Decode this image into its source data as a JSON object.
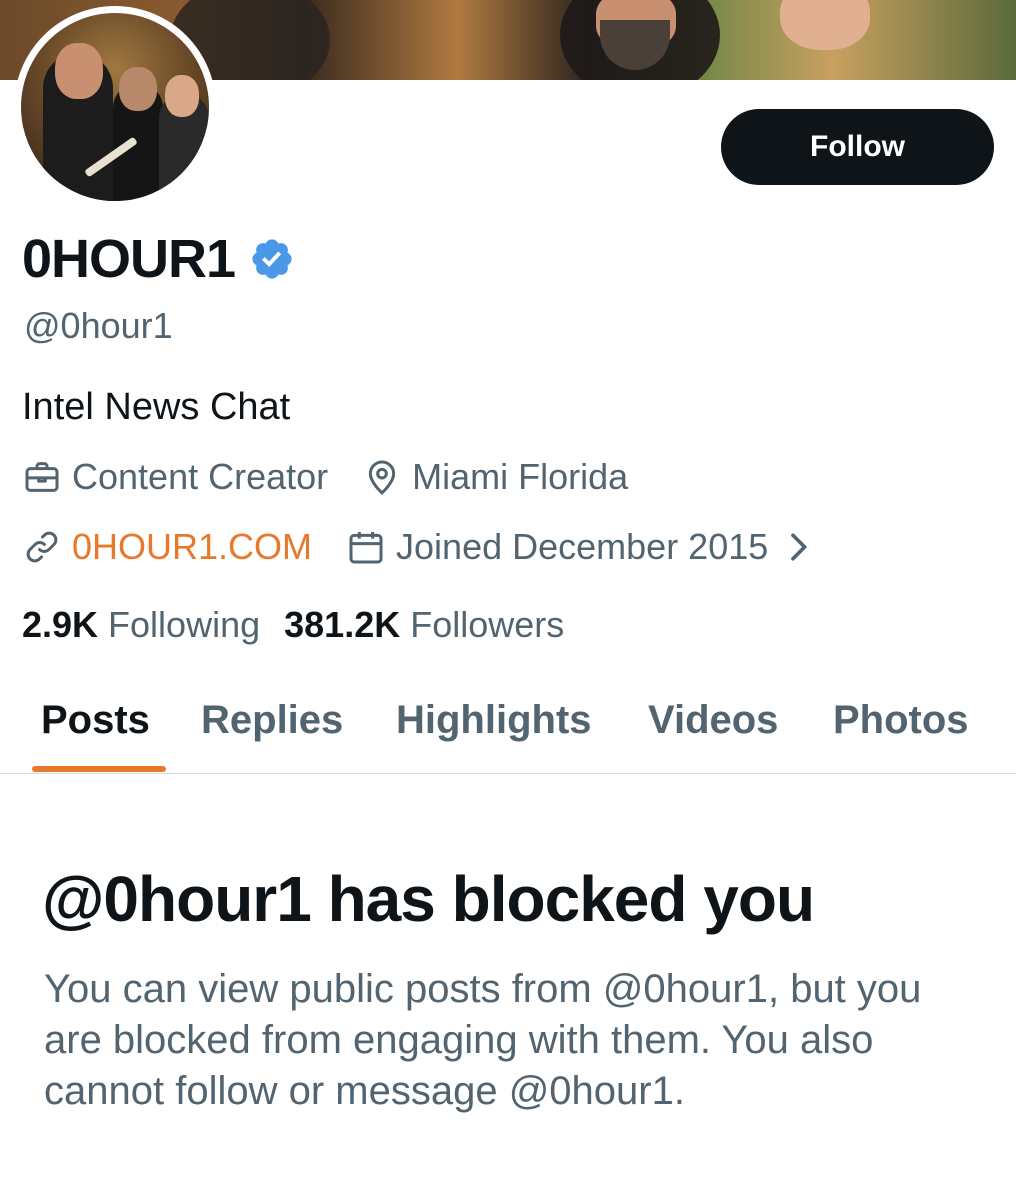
{
  "profile": {
    "display_name": "0HOUR1",
    "handle": "@0hour1",
    "bio": "Intel News Chat",
    "category": "Content Creator",
    "location": "Miami Florida",
    "website": "0HOUR1.COM",
    "joined": "Joined December 2015",
    "verified": true,
    "verified_color": "#4a99e9"
  },
  "follow_button": {
    "label": "Follow"
  },
  "stats": {
    "following_count": "2.9K",
    "following_label": "Following",
    "followers_count": "381.2K",
    "followers_label": "Followers"
  },
  "tabs": [
    {
      "label": "Posts",
      "active": true
    },
    {
      "label": "Replies",
      "active": false
    },
    {
      "label": "Highlights",
      "active": false
    },
    {
      "label": "Videos",
      "active": false
    },
    {
      "label": "Photos",
      "active": false
    }
  ],
  "blocked_notice": {
    "title": "@0hour1 has blocked you",
    "body": "You can view public posts from @0hour1, but you are blocked from engaging with them. You also cannot follow or message @0hour1."
  },
  "colors": {
    "accent": "#e8792c",
    "text_primary": "#0f1419",
    "text_secondary": "#536471",
    "button_bg": "#0f1419"
  },
  "icons": {
    "category": "briefcase-icon",
    "location": "location-pin-icon",
    "website": "link-icon",
    "joined": "calendar-icon",
    "joined_more": "chevron-right-icon",
    "verified": "verified-badge-icon"
  }
}
